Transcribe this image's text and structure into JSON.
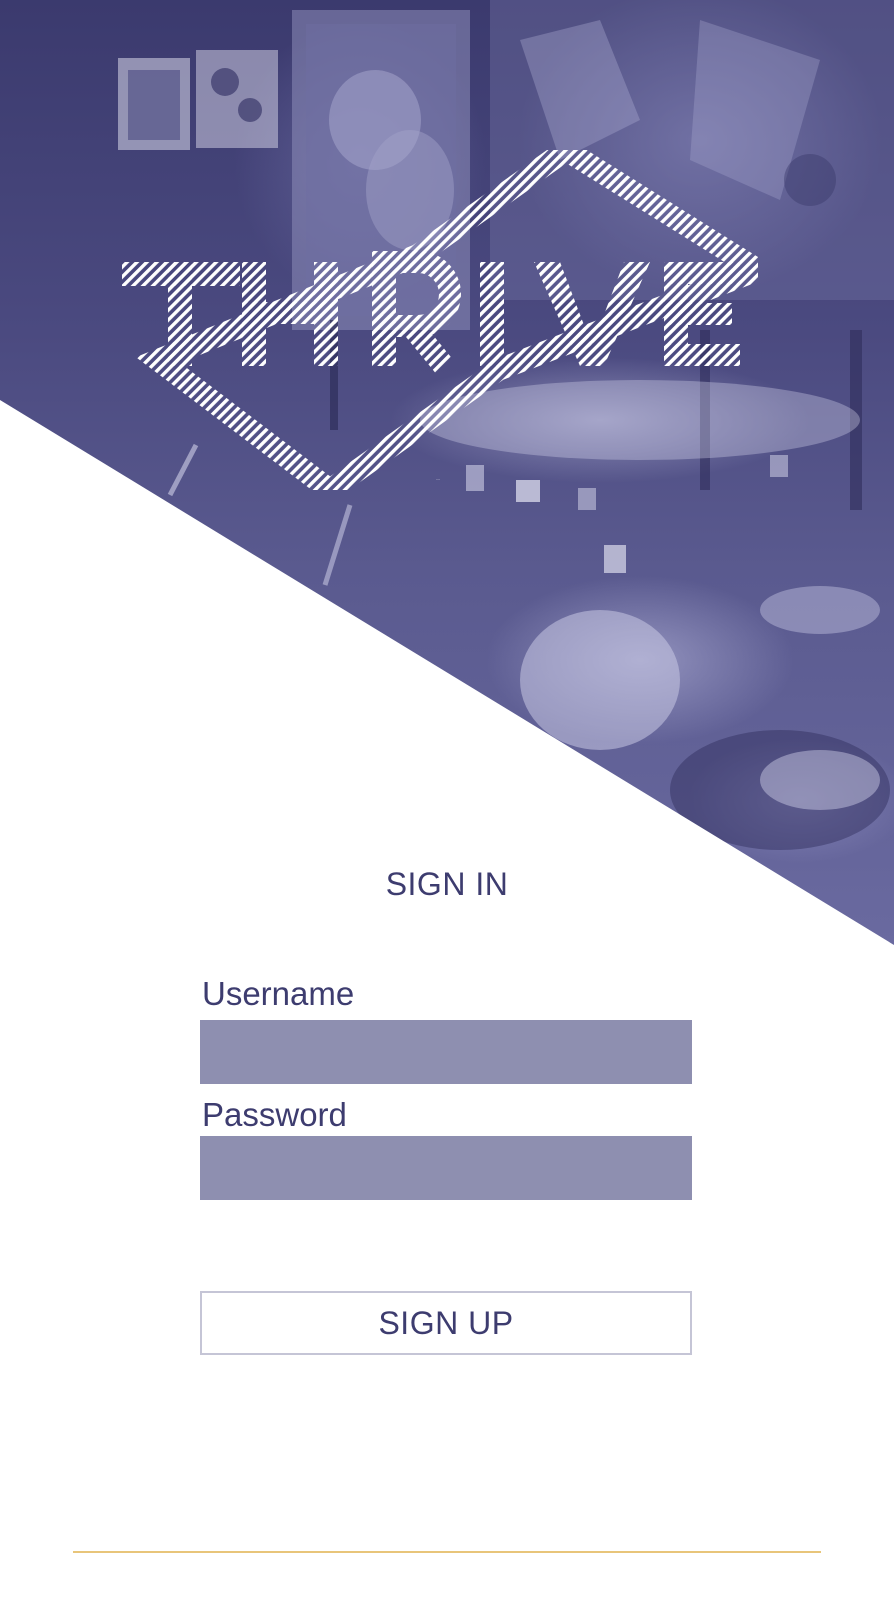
{
  "brand": {
    "logo_text": "THRIVE"
  },
  "colors": {
    "accent": "#3d3c6f",
    "input_fill": "#8e8fb0",
    "footer_rule": "#e8c57a"
  },
  "signin": {
    "title": "SIGN IN",
    "username_label": "Username",
    "username_value": "",
    "password_label": "Password",
    "password_value": "",
    "signup_label": "SIGN UP"
  }
}
